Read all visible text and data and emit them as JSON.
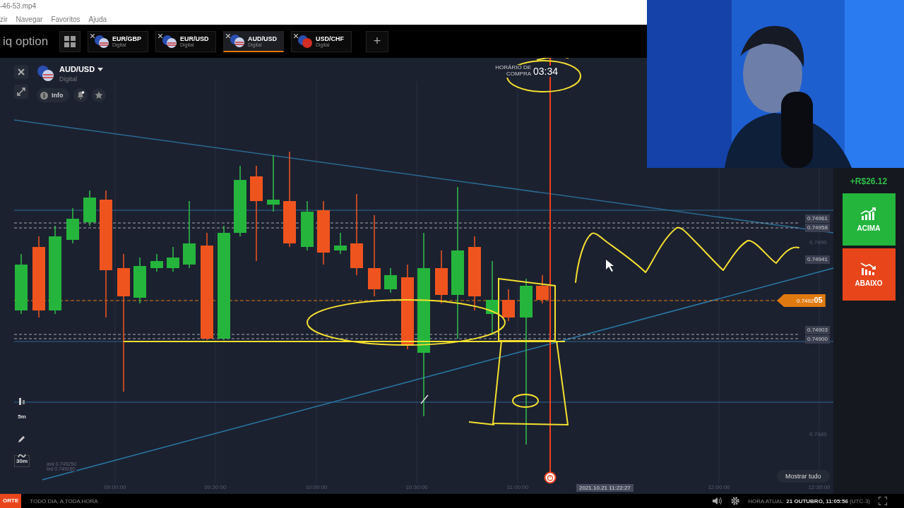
{
  "player": {
    "file_title": "-46-53.mp4",
    "menu": [
      "zir",
      "Navegar",
      "Favoritos",
      "Ajuda"
    ]
  },
  "brand": "iq option",
  "tabs": [
    {
      "pair": "EUR/GBP",
      "type": "Digital",
      "selected": false
    },
    {
      "pair": "EUR/USD",
      "type": "Digital",
      "selected": false
    },
    {
      "pair": "AUD/USD",
      "type": "Digital",
      "selected": true
    },
    {
      "pair": "USD/CHF",
      "type": "Digital",
      "selected": false
    }
  ],
  "add_tab": "+",
  "asset": {
    "pair": "AUD/USD",
    "type": "Digital",
    "info": "Info"
  },
  "timer": {
    "label": "HORÁRIO DE COMPRA",
    "time": "03:34"
  },
  "price_tags": [
    {
      "kind": "tag",
      "text": "0.74961"
    },
    {
      "kind": "tag",
      "text": "0.74958"
    },
    {
      "kind": "axis",
      "text": "0.7495"
    },
    {
      "kind": "tag",
      "text": "0.74941"
    },
    {
      "kind": "current",
      "text": "0.7492",
      "big": "05"
    },
    {
      "kind": "tag",
      "text": "0.74903"
    },
    {
      "kind": "tag",
      "text": "0.74900"
    },
    {
      "kind": "axis",
      "text": "0.7485"
    }
  ],
  "quote": {
    "ask": "ask 0.749250",
    "bid": "bid 0.749160"
  },
  "time_ticks": [
    "09:00:00",
    "09:30:00",
    "10:00:00",
    "10:30:00",
    "11:00:00",
    "12:00:00",
    "12:30:00"
  ],
  "cursor_time": "2021.10.21 11:22:27",
  "timeframes": [
    "5m",
    "30m"
  ],
  "profit": "+R$26.12",
  "trade_buttons": [
    {
      "kind": "up",
      "label": "ACIMA"
    },
    {
      "kind": "down",
      "label": "ABAIXO"
    }
  ],
  "show_all": "Mostrar tudo",
  "footer": {
    "badge": "ORTE",
    "slogan": "TODO DIA, A TODA HORA",
    "clock_label": "HORA ATUAL:",
    "clock_date": "21 OUTUBRO",
    "clock_time": ", 11:05:56",
    "timezone": "(UTC-3)"
  }
}
